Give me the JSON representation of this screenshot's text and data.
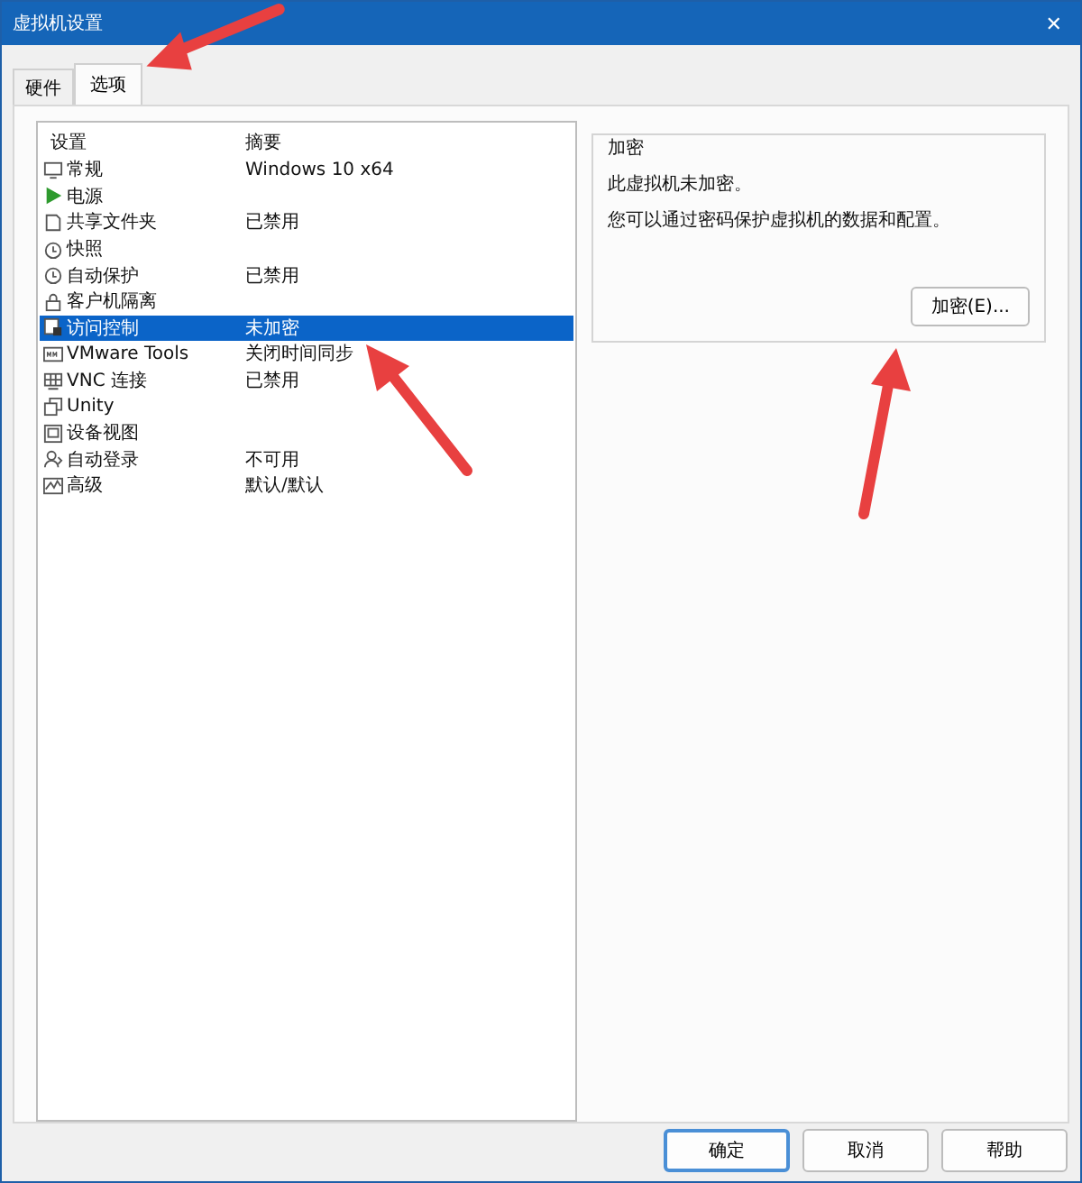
{
  "window": {
    "title": "虚拟机设置",
    "close": "✕"
  },
  "tabs": [
    {
      "label": "硬件",
      "selected": false
    },
    {
      "label": "选项",
      "selected": true
    }
  ],
  "settings_list": {
    "columns": [
      "设置",
      "摘要"
    ],
    "rows": [
      {
        "name": "常规",
        "summary": "Windows 10 x64",
        "selected": false
      },
      {
        "name": "电源",
        "selected": false
      },
      {
        "name": "共享文件夹",
        "summary": "已禁用",
        "selected": false
      },
      {
        "name": "快照",
        "selected": false
      },
      {
        "name": "自动保护",
        "summary": "已禁用",
        "selected": false
      },
      {
        "name": "客户机隔离",
        "selected": false
      },
      {
        "name": "访问控制",
        "summary": "未加密",
        "selected": true
      },
      {
        "name": "VMware Tools",
        "summary": "关闭时间同步",
        "selected": false
      },
      {
        "name": "VNC 连接",
        "summary": "已禁用",
        "selected": false
      },
      {
        "name": "Unity",
        "selected": false
      },
      {
        "name": "设备视图",
        "selected": false
      },
      {
        "name": "自动登录",
        "summary": "不可用",
        "selected": false
      },
      {
        "name": "高级",
        "summary": "默认/默认",
        "selected": false
      }
    ]
  },
  "encryption": {
    "title": "加密",
    "status": "此虚拟机未加密。",
    "hint": "您可以通过密码保护虚拟机的数据和配置。",
    "button": "加密(E)..."
  },
  "buttons": [
    {
      "label": "确定",
      "default": true
    },
    {
      "label": "取消",
      "default": false
    },
    {
      "label": "帮助",
      "default": false
    }
  ]
}
